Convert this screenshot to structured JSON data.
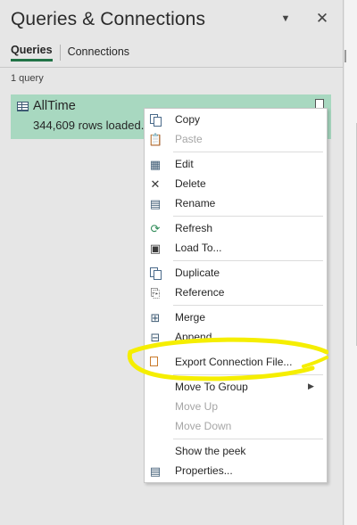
{
  "pane": {
    "title": "Queries & Connections",
    "options_glyph": "▼",
    "close_glyph": "✕"
  },
  "tabs": [
    {
      "label": "Queries",
      "active": true
    },
    {
      "label": "Connections",
      "active": false
    }
  ],
  "query_count": "1 query",
  "query": {
    "name": "AllTime",
    "status": "344,609 rows loaded."
  },
  "menu": {
    "items": [
      {
        "label": "Copy",
        "icon": "copy-icon",
        "disabled": false
      },
      {
        "label": "Paste",
        "icon": "paste-icon",
        "disabled": true
      },
      {
        "label": "Edit",
        "icon": "edit-icon",
        "disabled": false
      },
      {
        "label": "Delete",
        "icon": "delete-icon",
        "disabled": false
      },
      {
        "label": "Rename",
        "icon": "rename-icon",
        "disabled": false
      },
      {
        "label": "Refresh",
        "icon": "refresh-icon",
        "disabled": false
      },
      {
        "label": "Load To...",
        "icon": "load-to-icon",
        "disabled": false
      },
      {
        "label": "Duplicate",
        "icon": "duplicate-icon",
        "disabled": false
      },
      {
        "label": "Reference",
        "icon": "reference-icon",
        "disabled": false
      },
      {
        "label": "Merge",
        "icon": "merge-icon",
        "disabled": false
      },
      {
        "label": "Append",
        "icon": "append-icon",
        "disabled": false
      },
      {
        "label": "Export Connection File...",
        "icon": "export-connection-icon",
        "disabled": false
      },
      {
        "label": "Move To Group",
        "icon": "",
        "disabled": false,
        "submenu": true
      },
      {
        "label": "Move Up",
        "icon": "",
        "disabled": true
      },
      {
        "label": "Move Down",
        "icon": "",
        "disabled": true
      },
      {
        "label": "Show the peek",
        "icon": "",
        "disabled": false
      },
      {
        "label": "Properties...",
        "icon": "properties-icon",
        "disabled": false
      }
    ]
  },
  "colors": {
    "selected_query_bg": "#a8d8c0",
    "active_tab_underline": "#217346",
    "annotation_highlight": "#f5ee00"
  }
}
